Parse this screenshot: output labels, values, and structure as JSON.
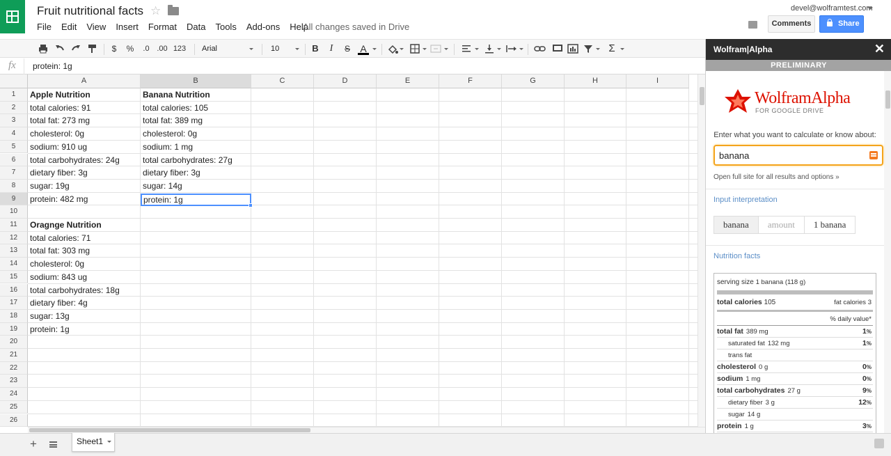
{
  "header": {
    "doc_title": "Fruit nutritional facts",
    "menu": [
      "File",
      "Edit",
      "View",
      "Insert",
      "Format",
      "Data",
      "Tools",
      "Add-ons",
      "Help"
    ],
    "save_status": "All changes saved in Drive",
    "account": "devel@wolframtest.com",
    "comments_label": "Comments",
    "share_label": "Share"
  },
  "toolbar": {
    "currency": "$",
    "percent": "%",
    "dec_less": ".0",
    "dec_more": ".00",
    "more_formats": "123",
    "font": "Arial",
    "font_size": "10",
    "bold": "B",
    "italic": "I",
    "strike": "S",
    "text_color": "A",
    "functions": "Σ"
  },
  "formula": {
    "fx": "fx",
    "value": "protein: 1g"
  },
  "grid": {
    "columns": [
      "A",
      "B",
      "C",
      "D",
      "E",
      "F",
      "G",
      "H",
      "I"
    ],
    "selected_column": "B",
    "selected_row": 9,
    "rows": [
      "1",
      "2",
      "3",
      "4",
      "5",
      "6",
      "7",
      "8",
      "9",
      "10",
      "11",
      "12",
      "13",
      "14",
      "15",
      "16",
      "17",
      "18",
      "19",
      "20",
      "21",
      "22",
      "23",
      "24",
      "25",
      "26"
    ],
    "colA": [
      "Apple Nutrition",
      "total calories: 91",
      "total fat: 273 mg",
      "cholesterol: 0g",
      "sodium: 910 ug",
      "total carbohydrates: 24g",
      "dietary fiber: 3g",
      "sugar: 19g",
      "protein: 482 mg",
      "",
      "Oragnge Nutrition",
      "total calories: 71",
      "total fat: 303 mg",
      "cholesterol: 0g",
      "sodium: 843 ug",
      "total carbohydrates: 18g",
      "dietary fiber: 4g",
      "sugar: 13g",
      "protein: 1g"
    ],
    "colB": [
      "Banana Nutrition",
      "total calories: 105",
      "total fat: 389 mg",
      "cholesterol: 0g",
      "sodium: 1 mg",
      "total carbohydrates: 27g",
      "dietary fiber: 3g",
      "sugar: 14g",
      "protein: 1g"
    ]
  },
  "sheets": {
    "tabs": [
      "Sheet1"
    ]
  },
  "wolfram": {
    "title": "Wolfram|Alpha",
    "banner": "PRELIMINARY",
    "logo_text": "WolframAlpha",
    "logo_sub": "FOR GOOGLE DRIVE",
    "prompt": "Enter what you want to calculate or know about:",
    "query": "banana",
    "full_site": "Open full site for all results and options »",
    "input_interp_label": "Input interpretation",
    "interp": [
      "banana",
      "amount",
      "1 banana"
    ],
    "nutrition_label": "Nutrition facts",
    "nutrition": {
      "serving_label": "serving size",
      "serving_value": "1 banana (118 g)",
      "calories_label": "total calories",
      "calories_value": "105",
      "fat_calories_label": "fat calories",
      "fat_calories_value": "3",
      "daily_value": "% daily value*",
      "rows": [
        {
          "label": "total fat",
          "amount": "389 mg",
          "pct": "1",
          "bold": true,
          "indent": false
        },
        {
          "label": "saturated fat",
          "amount": "132 mg",
          "pct": "1",
          "bold": false,
          "indent": true
        },
        {
          "label": "trans fat",
          "amount": "",
          "pct": "",
          "bold": false,
          "indent": true
        },
        {
          "label": "cholesterol",
          "amount": "0 g",
          "pct": "0",
          "bold": true,
          "indent": false
        },
        {
          "label": "sodium",
          "amount": "1 mg",
          "pct": "0",
          "bold": true,
          "indent": false
        },
        {
          "label": "total carbohydrates",
          "amount": "27 g",
          "pct": "9",
          "bold": true,
          "indent": false
        },
        {
          "label": "dietary fiber",
          "amount": "3 g",
          "pct": "12",
          "bold": false,
          "indent": true
        },
        {
          "label": "sugar",
          "amount": "14 g",
          "pct": "",
          "bold": false,
          "indent": true
        },
        {
          "label": "protein",
          "amount": "1 g",
          "pct": "3",
          "bold": true,
          "indent": false
        }
      ]
    }
  }
}
